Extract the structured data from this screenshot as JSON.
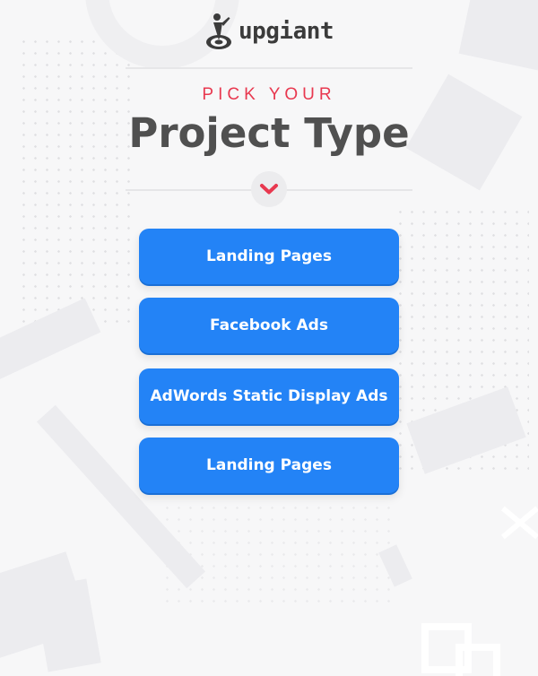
{
  "header": {
    "logo_text": "upgiant"
  },
  "intro": {
    "pick_label": "PICK YOUR",
    "title": "Project Type"
  },
  "options": [
    {
      "label": "Landing Pages"
    },
    {
      "label": "Facebook Ads"
    },
    {
      "label": "AdWords Static Display Ads"
    },
    {
      "label": "Landing Pages"
    }
  ],
  "colors": {
    "accent_red": "#e8384f",
    "button_blue": "#2383f6",
    "title_gray": "#505050"
  },
  "icons": {
    "logo": "person-target-logo-icon",
    "scroll": "chevron-down-icon"
  }
}
